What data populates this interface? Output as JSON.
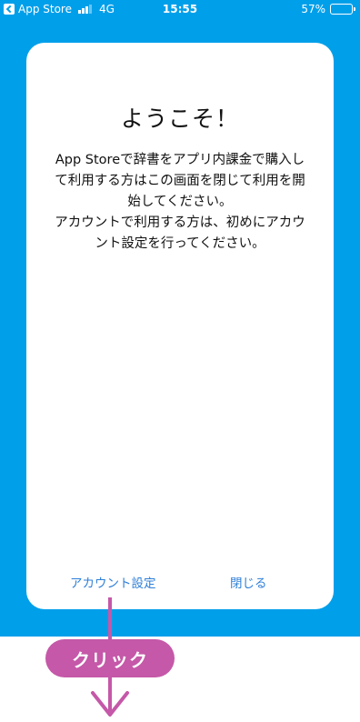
{
  "status_bar": {
    "back_app": "App Store",
    "network": "4G",
    "time": "15:55",
    "battery_percent": "57%",
    "battery_level": 0.57,
    "signal_bars_filled": 3,
    "signal_bars_total": 4,
    "icons": [
      "back-icon",
      "signal-icon",
      "battery-icon"
    ]
  },
  "dialog": {
    "title": "ようこそ！",
    "body_lines": [
      "App Storeで辞書をアプリ内課金で購入し",
      "て利用する方はこの画面を閉じて利用を開",
      "始してください。",
      "アカウントで利用する方は、初めにアカウ",
      "ント設定を行ってください。"
    ],
    "account_button_label": "アカウント設定",
    "close_button_label": "閉じる"
  },
  "annotation": {
    "label": "クリック",
    "color": "#c558a8",
    "icons": [
      "down-arrow-icon"
    ]
  },
  "colors": {
    "background": "#009fea",
    "dialog": "#ffffff",
    "link": "#2f7fd8",
    "annotation": "#c558a8"
  }
}
